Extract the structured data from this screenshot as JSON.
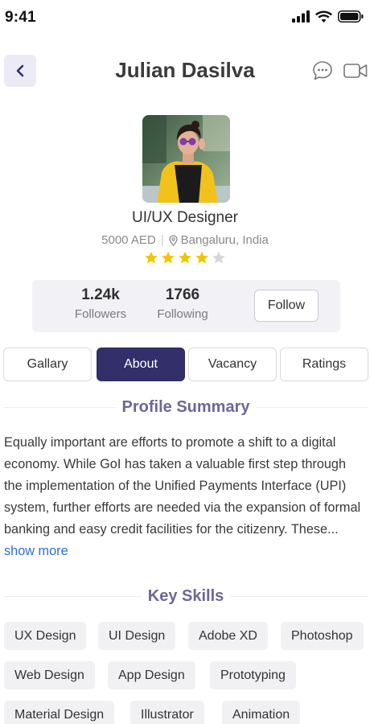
{
  "status_bar": {
    "time": "9:41"
  },
  "header": {
    "title": "Julian Dasilva"
  },
  "profile": {
    "role": "UI/UX Designer",
    "rate": "5000 AED",
    "location": "Bangaluru, India",
    "rating": 4,
    "rating_max": 5
  },
  "stats": {
    "followers": {
      "value": "1.24k",
      "label": "Followers"
    },
    "following": {
      "value": "1766",
      "label": "Following"
    },
    "follow_label": "Follow"
  },
  "tabs": [
    {
      "label": "Gallary",
      "active": false
    },
    {
      "label": "About",
      "active": true
    },
    {
      "label": "Vacancy",
      "active": false
    },
    {
      "label": "Ratings",
      "active": false
    }
  ],
  "summary": {
    "heading": "Profile Summary",
    "text": "Equally important are efforts to promote a shift to a digital economy. While GoI has taken a valuable first step through the implementation of the Unified Payments Interface (UPI) system, further efforts are needed via the expansion of formal banking and easy credit facilities for the citizenry. These...",
    "show_more": "show more"
  },
  "skills": {
    "heading": "Key Skills",
    "items": [
      "UX Design",
      "UI Design",
      "Adobe XD",
      "Photoshop",
      "Web Design",
      "App Design",
      "Prototyping",
      "Material Design",
      "Illustrator",
      "Animation"
    ]
  },
  "colors": {
    "accent": "#322f6a",
    "heading": "#6d6797",
    "star": "#f4c400",
    "star_empty": "#d7d7d7",
    "link": "#2d6fd6"
  }
}
